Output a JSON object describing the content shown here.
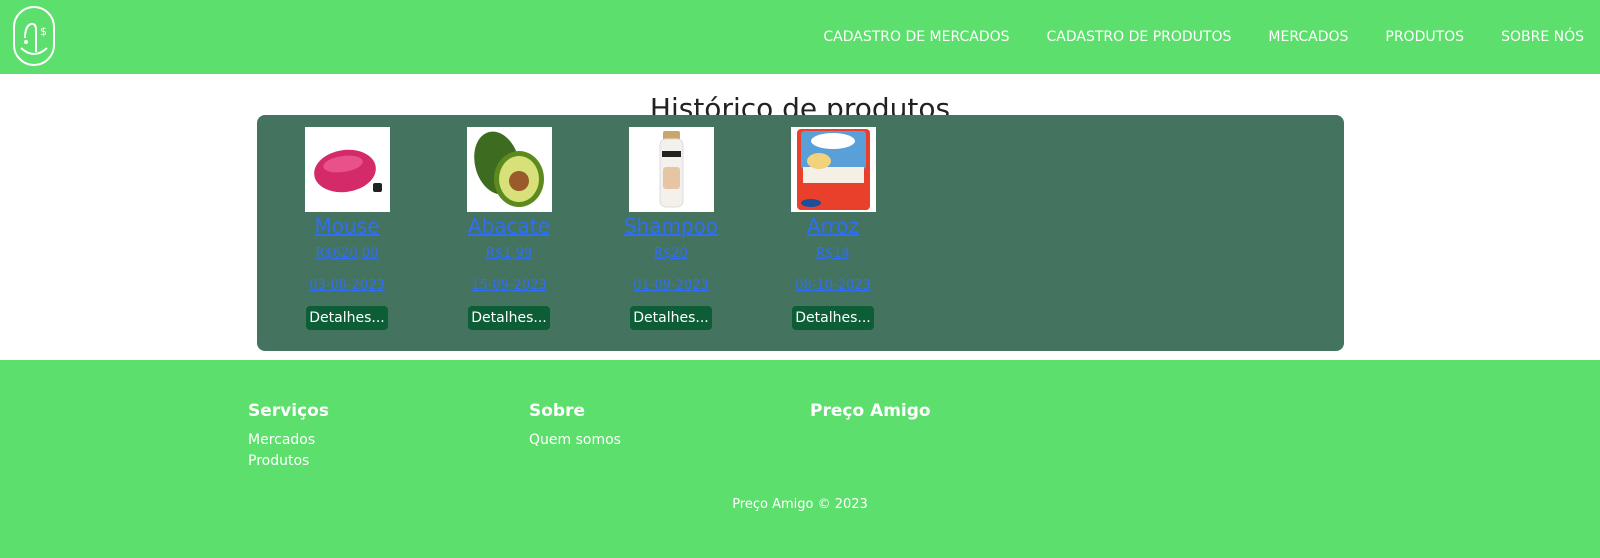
{
  "header": {
    "nav": [
      "CADASTRO DE MERCADOS",
      "CADASTRO DE PRODUTOS",
      "MERCADOS",
      "PRODUTOS",
      "SOBRE NÓS"
    ]
  },
  "main": {
    "title": "Histórico de produtos",
    "products": [
      {
        "name": "Mouse",
        "price": "R$620,00",
        "date": "03-08-2023",
        "button": "Detalhes..."
      },
      {
        "name": "Abacate",
        "price": "R$1,99",
        "date": "15-09-2023",
        "button": "Detalhes..."
      },
      {
        "name": "Shampoo",
        "price": "R$20",
        "date": "01-09-2023",
        "button": "Detalhes..."
      },
      {
        "name": "Arroz",
        "price": "R$14",
        "date": "08-10-2023",
        "button": "Detalhes..."
      }
    ]
  },
  "footer": {
    "columns": [
      {
        "title": "Serviços",
        "links": [
          "Mercados",
          "Produtos"
        ]
      },
      {
        "title": "Sobre",
        "links": [
          "Quem somos"
        ]
      },
      {
        "title": "Preço Amigo",
        "links": []
      }
    ],
    "copyright": "Preço Amigo © 2023"
  },
  "colors": {
    "header_bg": "#5cdf6c",
    "panel_bg": "#447460",
    "button_bg": "#0d5e36",
    "link": "#2f6ff0"
  }
}
